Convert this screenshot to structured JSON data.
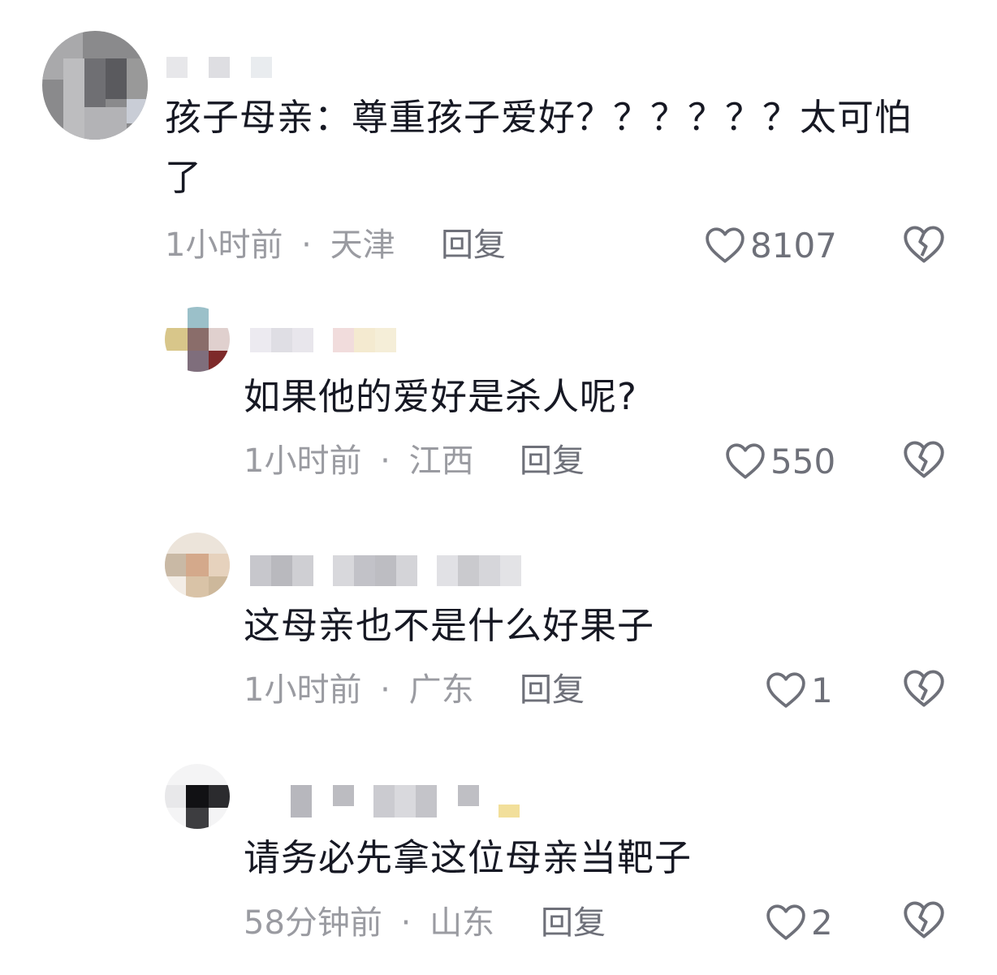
{
  "comments": [
    {
      "text": "孩子母亲：尊重孩子爱好？？？？？？太可怕了",
      "time": "1小时前",
      "location": "天津",
      "reply_label": "回复",
      "likes": "8107"
    },
    {
      "text": "如果他的爱好是杀人呢?",
      "time": "1小时前",
      "location": "江西",
      "reply_label": "回复",
      "likes": "550"
    },
    {
      "text": "这母亲也不是什么好果子",
      "time": "1小时前",
      "location": "广东",
      "reply_label": "回复",
      "likes": "1"
    },
    {
      "text": "请务必先拿这位母亲当靶子",
      "time": "58分钟前",
      "location": "山东",
      "reply_label": "回复",
      "likes": "2"
    }
  ],
  "meta_separator": "·",
  "icons": {
    "like": "heart-outline-icon",
    "dislike": "broken-heart-icon"
  },
  "colors": {
    "text": "#161823",
    "meta": "#9a9ba1",
    "action": "#6e7079"
  }
}
